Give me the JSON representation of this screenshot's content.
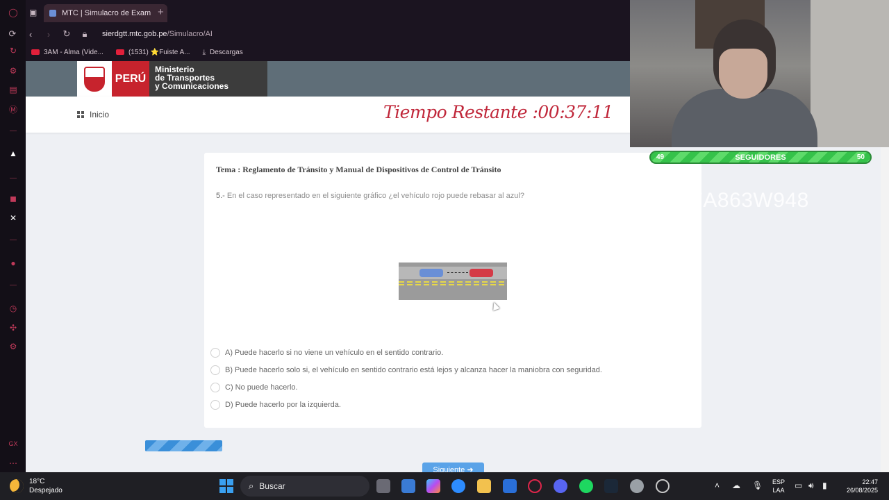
{
  "browser": {
    "tab_title": "MTC | Simulacro de Exam",
    "new_tab": "+",
    "url_host": "sierdgtt.mtc.gob.pe",
    "url_path": "/Simulacro/AI",
    "bookmarks": [
      "3AM - Alma (Vide...",
      "(1531) ⭐Fuiste A...",
      "Descargas"
    ]
  },
  "header": {
    "peru": "PERÚ",
    "ministry_line1": "Ministerio",
    "ministry_line2": "de Transportes",
    "ministry_line3": "y Comunicaciones",
    "home_label": "Inicio",
    "timer": "Tiempo Restante :00:37:11"
  },
  "exam": {
    "topic": "Tema : Reglamento de Tránsito y Manual de Dispositivos de Control de Tránsito",
    "question_number": "5.-",
    "question_text": "En el caso representado en el siguiente gráfico ¿el vehículo rojo puede rebasar al azul?",
    "options": [
      "A) Puede hacerlo si no viene un vehículo en el sentido contrario.",
      "B) Puede hacerlo solo si, el vehículo en sentido contrario está lejos y alcanza hacer la maniobra con seguridad.",
      "C) No puede hacerlo.",
      "D) Puede hacerlo por la izquierda."
    ],
    "next_label": "Siguiente ➜"
  },
  "overlay": {
    "followers_current": "49",
    "followers_label": "SEGUIDORES",
    "followers_goal": "50",
    "watermark": "27A863W948"
  },
  "taskbar": {
    "temperature": "18°C",
    "weather": "Despejado",
    "search_placeholder": "Buscar",
    "lang_top": "ESP",
    "lang_bottom": "LAA",
    "time": "22:47",
    "date": "26/08/2025"
  },
  "colors": {
    "timer_red": "#c0273a",
    "mtc_bar": "#5f6e78",
    "peru_red": "#c7232d",
    "progress_blue": "#3a8fd9"
  }
}
